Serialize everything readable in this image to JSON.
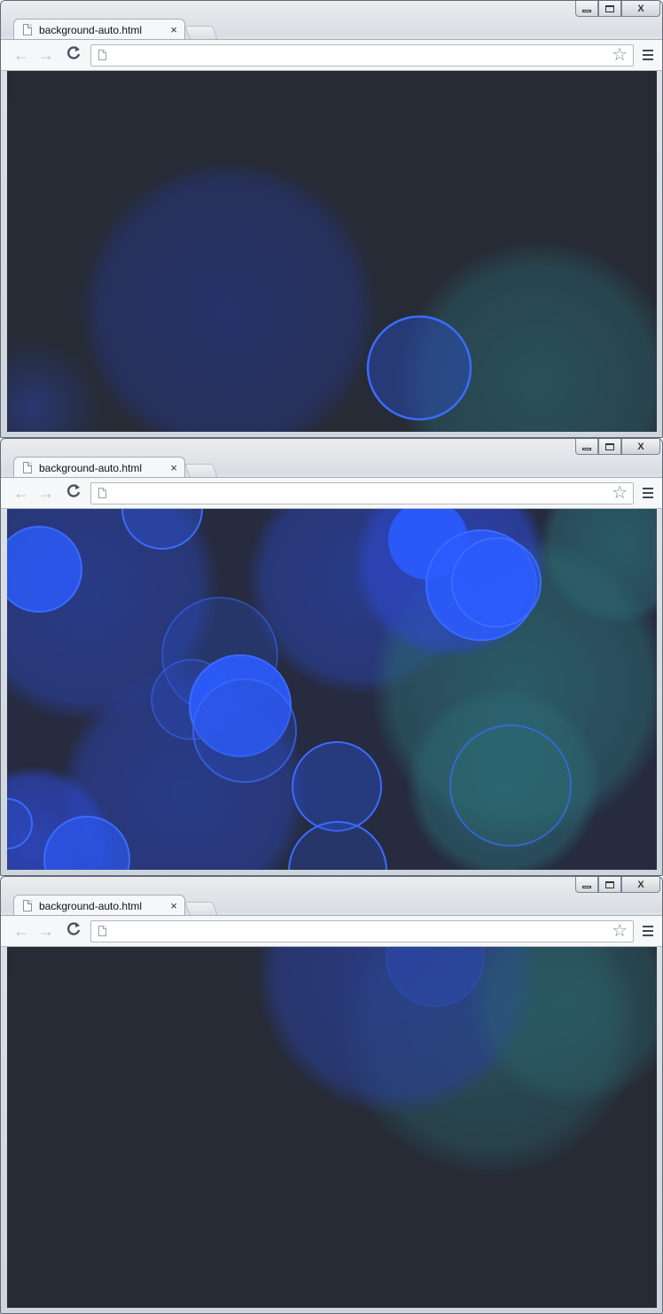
{
  "windows": [
    {
      "tab_title": "background-auto.html",
      "url": "",
      "scene": "sparse",
      "controls": {
        "minimize": "minimize-icon",
        "maximize": "maximize-icon",
        "close": "close-icon"
      }
    },
    {
      "tab_title": "background-auto.html",
      "url": "",
      "scene": "dense",
      "controls": {
        "minimize": "minimize-icon",
        "maximize": "maximize-icon",
        "close": "close-icon"
      }
    },
    {
      "tab_title": "background-auto.html",
      "url": "",
      "scene": "faded",
      "controls": {
        "minimize": "minimize-icon",
        "maximize": "maximize-icon",
        "close": "close-icon"
      }
    }
  ],
  "icons": {
    "close_glyph": "×",
    "window_close_glyph": "X",
    "back": "←",
    "forward": "→",
    "reload": "C",
    "star": "☆"
  },
  "colors": {
    "page_background": "#262b35",
    "bubble_blue": "#2b5cff",
    "bubble_teal": "#2c6a73"
  }
}
